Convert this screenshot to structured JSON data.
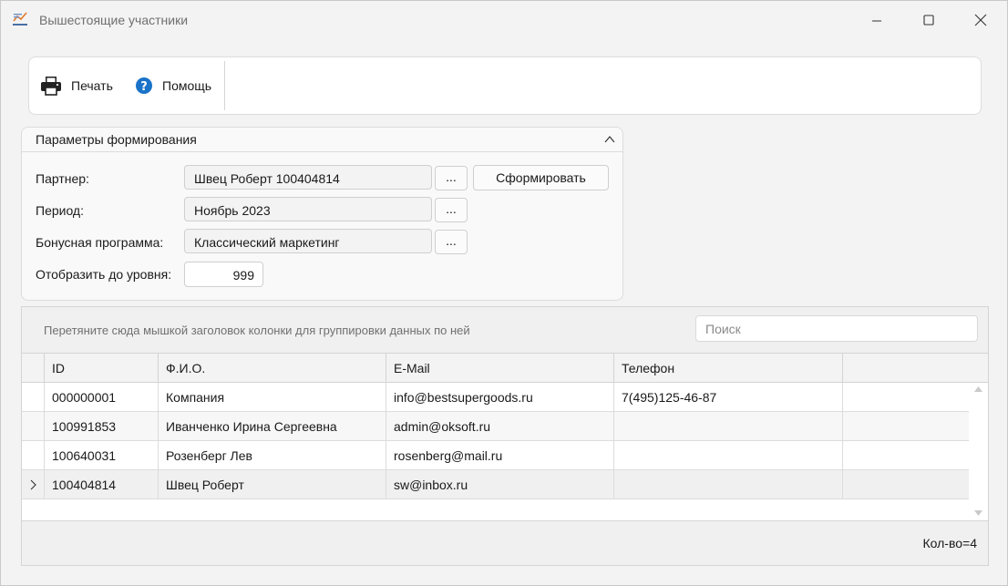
{
  "window": {
    "title": "Вышестоящие участники"
  },
  "toolbar": {
    "print_label": "Печать",
    "help_label": "Помощь"
  },
  "params": {
    "title": "Параметры формирования",
    "partner_label": "Партнер:",
    "partner_value": "Швец Роберт 100404814",
    "period_label": "Период:",
    "period_value": "Ноябрь 2023",
    "program_label": "Бонусная программа:",
    "program_value": "Классический маркетинг",
    "level_label": "Отобразить до уровня:",
    "level_value": "999",
    "browse_label": "...",
    "generate_label": "Сформировать"
  },
  "grid": {
    "group_hint": "Перетяните сюда мышкой заголовок колонки для группировки данных по ней",
    "search_placeholder": "Поиск",
    "columns": [
      "ID",
      "Ф.И.О.",
      "E-Mail",
      "Телефон"
    ],
    "rows": [
      {
        "id": "000000001",
        "name": "Компания",
        "email": "info@bestsupergoods.ru",
        "phone": "7(495)125-46-87"
      },
      {
        "id": "100991853",
        "name": "Иванченко Ирина Сергеевна",
        "email": "admin@oksoft.ru",
        "phone": ""
      },
      {
        "id": "100640031",
        "name": "Розенберг Лев",
        "email": "rosenberg@mail.ru",
        "phone": ""
      },
      {
        "id": "100404814",
        "name": "Швец Роберт",
        "email": "sw@inbox.ru",
        "phone": ""
      }
    ],
    "count_text": "Кол-во=4"
  },
  "icons": {
    "app": "chart-icon",
    "print": "printer-icon",
    "help": "question-icon",
    "help_color": "#1a73c8"
  }
}
